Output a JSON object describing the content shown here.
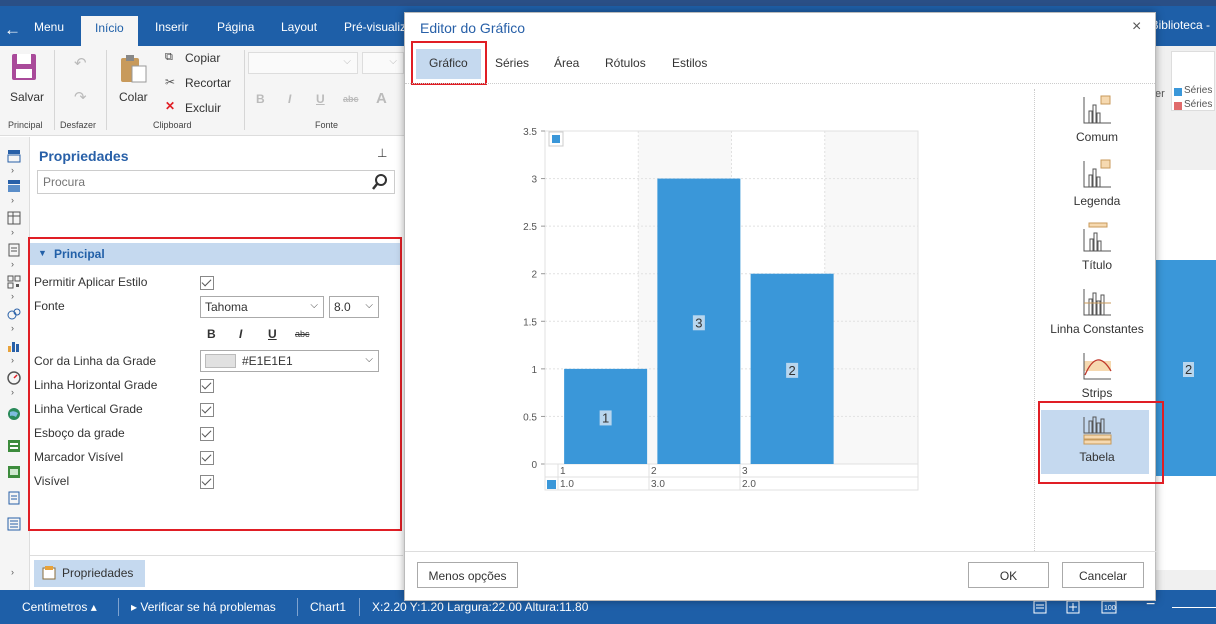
{
  "topnav": {
    "menu": "Menu",
    "tabs": [
      "Início",
      "Inserir",
      "Página",
      "Layout",
      "Pré-visualiz"
    ],
    "library": "Biblioteca -"
  },
  "ribbon": {
    "save": "Salvar",
    "paste": "Colar",
    "copy": "Copiar",
    "cut": "Recortar",
    "delete": "Excluir",
    "groups": [
      "Principal",
      "Desfazer",
      "Clipboard",
      "Fonte"
    ],
    "series_legend": [
      "Séries",
      "Séries"
    ],
    "partial_text": "er"
  },
  "properties": {
    "title": "Propriedades",
    "search_placeholder": "Procura",
    "section": "Principal",
    "rows": {
      "allow_style": "Permitir Aplicar Estilo",
      "font": "Fonte",
      "grid_color": "Cor da Linha da Grade",
      "hgrid": "Linha Horizontal Grade",
      "vgrid": "Linha Vertical Grade",
      "outline": "Esboço da grade",
      "marker": "Marcador Visível",
      "visible": "Visível"
    },
    "font_name": "Tahoma",
    "font_size": "8.0",
    "font_styles": [
      "B",
      "I",
      "U",
      "abc"
    ],
    "grid_color_value": "#E1E1E1",
    "bottom_button": "Propriedades"
  },
  "modal": {
    "title": "Editor do Gráfico",
    "close": "×",
    "tabs": [
      "Gráfico",
      "Séries",
      "Área",
      "Rótulos",
      "Estilos"
    ],
    "selected_tab": "Gráfico",
    "chart_types": [
      "Comum",
      "Legenda",
      "Título",
      "Linha Constantes",
      "Strips",
      "Tabela"
    ],
    "selected_chart_type": "Tabela",
    "less_options": "Menos opções",
    "ok": "OK",
    "cancel": "Cancelar"
  },
  "chart_data": {
    "type": "bar",
    "categories": [
      "1",
      "2",
      "3"
    ],
    "values": [
      1,
      3,
      2
    ],
    "ylim": [
      0,
      3.5
    ],
    "yticks": [
      "0",
      "0.5",
      "1",
      "1.5",
      "2",
      "2.5",
      "3",
      "3.5"
    ],
    "table_values": [
      "1.0",
      "3.0",
      "2.0"
    ],
    "color": "#3a97d9",
    "grid": true
  },
  "status": {
    "units": "Centímetros",
    "check": "Verificar se há problemas",
    "chart": "Chart1",
    "coords": "X:2.20 Y:1.20 Largura:22.00 Altura:11.80"
  },
  "background": {
    "bar_label": "2"
  }
}
